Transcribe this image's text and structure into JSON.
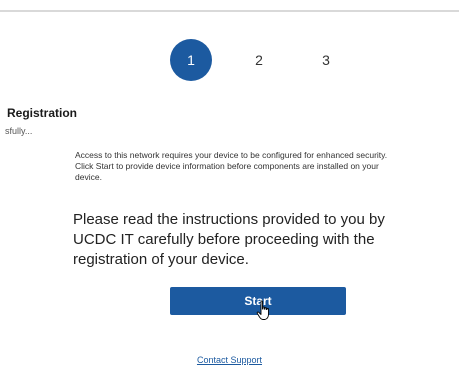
{
  "steps": [
    "1",
    "2",
    "3"
  ],
  "active_step": 1,
  "section": {
    "title": "Registration",
    "subtitle": "sfully..."
  },
  "info_text": "Access to this network requires your device to be configured for enhanced security. Click Start to provide device information before components are installed on your device.",
  "instructions": "Please read the instructions provided to you by UCDC IT carefully before proceeding with the registration of your device.",
  "start_button_label": "Start",
  "contact_support_label": "Contact Support",
  "colors": {
    "accent": "#1c5aa0"
  },
  "icons": {
    "cursor": "hand-pointer-icon"
  }
}
